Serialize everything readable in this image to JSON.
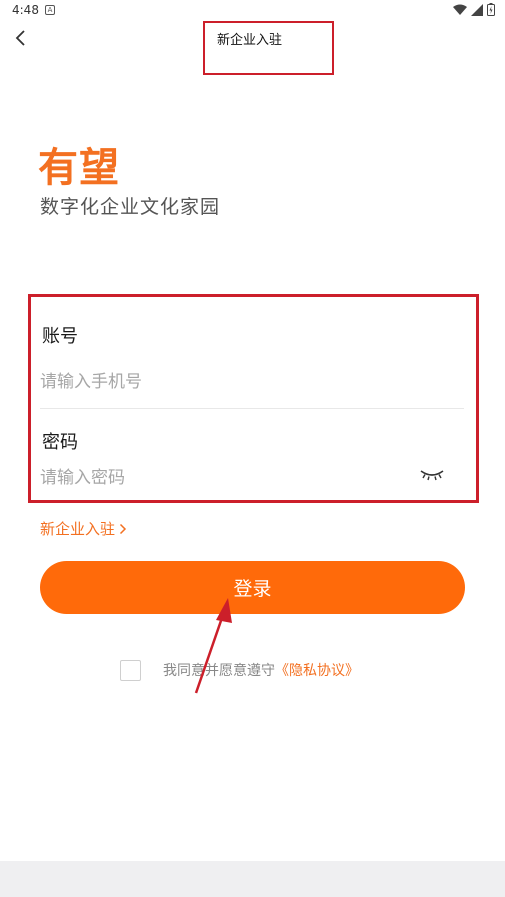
{
  "status_bar": {
    "time": "4:48",
    "notification_glyph": "A"
  },
  "header": {
    "title": "新企业入驻"
  },
  "brand": {
    "title": "有望",
    "subtitle": "数字化企业文化家园"
  },
  "form": {
    "account": {
      "label": "账号",
      "placeholder": "请输入手机号",
      "value": ""
    },
    "password": {
      "label": "密码",
      "placeholder": "请输入密码",
      "value": ""
    }
  },
  "register_link": {
    "label": "新企业入驻"
  },
  "login_button": {
    "label": "登录"
  },
  "agreement": {
    "prefix": "我同意并愿意遵守",
    "link": "《隐私协议》",
    "checked": false
  },
  "colors": {
    "brand_orange": "#f37021",
    "button_orange": "#ff6a0a",
    "annotation_red": "#cc1f2a"
  },
  "icons": [
    "back-arrow-icon",
    "eye-closed-icon",
    "chevron-right-icon",
    "wifi-icon",
    "signal-icon",
    "battery-icon"
  ]
}
